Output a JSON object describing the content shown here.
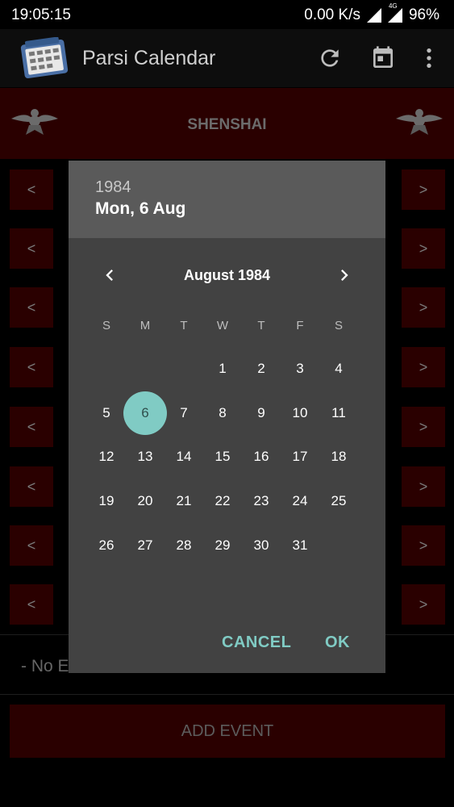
{
  "status_bar": {
    "time": "19:05:15",
    "network_speed": "0.00 K/s",
    "network_type": "4G",
    "battery": "96%"
  },
  "app_bar": {
    "title": "Parsi Calendar",
    "icons": [
      "app-logo-icon",
      "refresh-icon",
      "calendar-icon",
      "more-vert-icon"
    ]
  },
  "header": {
    "title": "SHENSHAI"
  },
  "rows": {
    "prev_label": "<",
    "next_label": ">"
  },
  "events": {
    "no_events_text": "- No E"
  },
  "add_event": {
    "label": "ADD EVENT"
  },
  "dialog": {
    "year": "1984",
    "selected_date": "Mon, 6 Aug",
    "month_label": "August 1984",
    "weekdays": [
      "S",
      "M",
      "T",
      "W",
      "T",
      "F",
      "S"
    ],
    "first_weekday_index": 3,
    "days_in_month": 31,
    "selected_day": 6,
    "days": [
      "1",
      "2",
      "3",
      "4",
      "5",
      "6",
      "7",
      "8",
      "9",
      "10",
      "11",
      "12",
      "13",
      "14",
      "15",
      "16",
      "17",
      "18",
      "19",
      "20",
      "21",
      "22",
      "23",
      "24",
      "25",
      "26",
      "27",
      "28",
      "29",
      "30",
      "31"
    ],
    "cancel_label": "CANCEL",
    "ok_label": "OK",
    "accent_color": "#80cbc4"
  }
}
